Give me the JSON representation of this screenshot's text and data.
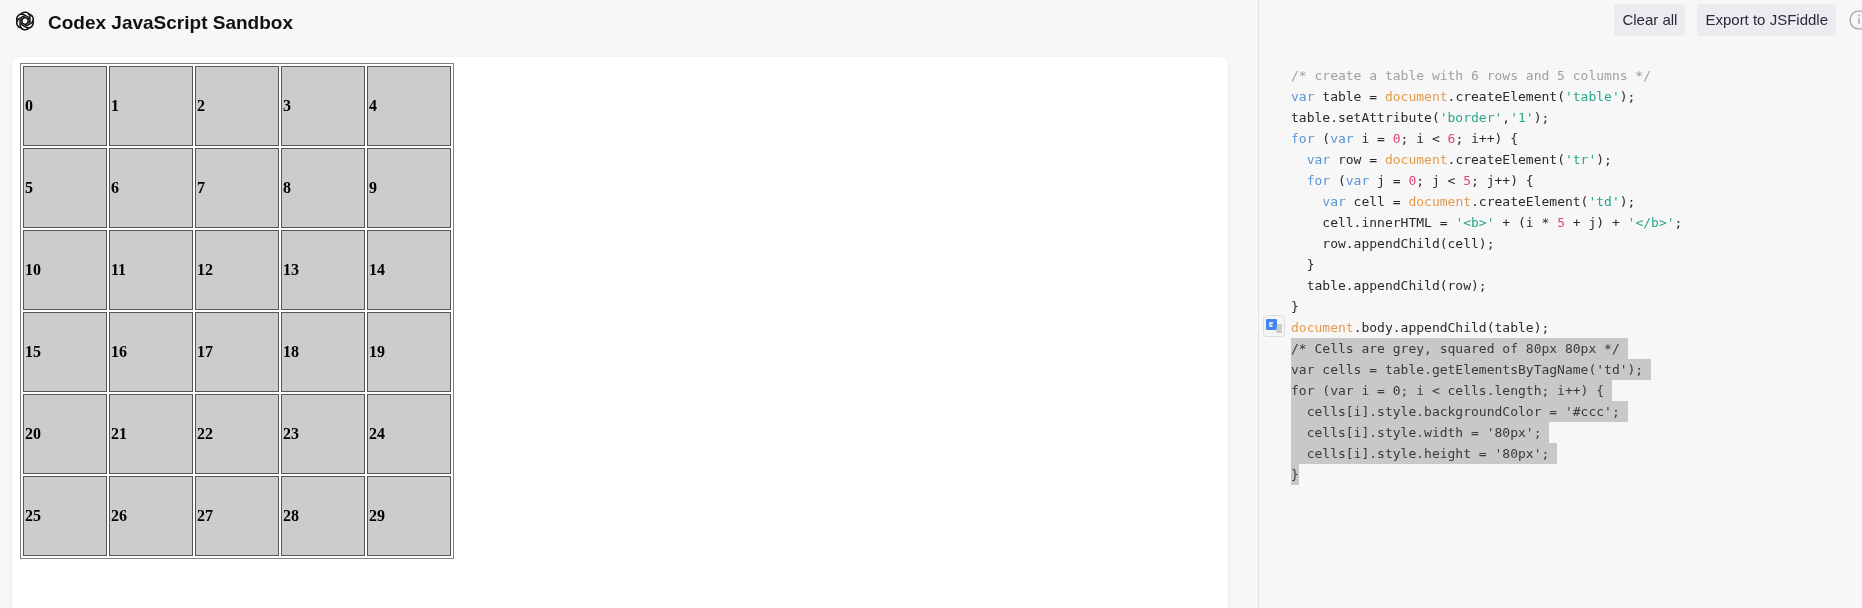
{
  "header": {
    "title": "Codex JavaScript Sandbox"
  },
  "toolbar": {
    "buttons": [
      "Clear all",
      "Export to JSFiddle"
    ]
  },
  "output": {
    "table": {
      "rows": [
        [
          "0",
          "1",
          "2",
          "3",
          "4"
        ],
        [
          "5",
          "6",
          "7",
          "8",
          "9"
        ],
        [
          "10",
          "11",
          "12",
          "13",
          "14"
        ],
        [
          "15",
          "16",
          "17",
          "18",
          "19"
        ],
        [
          "20",
          "21",
          "22",
          "23",
          "24"
        ],
        [
          "25",
          "26",
          "27",
          "28",
          "29"
        ]
      ]
    }
  },
  "code": {
    "lines": [
      {
        "selected": false,
        "tokens": [
          {
            "kind": "comment",
            "text": "/* create a table with 6 rows and 5 columns */"
          }
        ]
      },
      {
        "selected": false,
        "tokens": [
          {
            "kind": "keyword",
            "text": "var"
          },
          {
            "kind": "plain",
            "text": " table = "
          },
          {
            "kind": "object",
            "text": "document"
          },
          {
            "kind": "plain",
            "text": ".createElement("
          },
          {
            "kind": "string",
            "text": "'table'"
          },
          {
            "kind": "plain",
            "text": ");"
          }
        ]
      },
      {
        "selected": false,
        "tokens": [
          {
            "kind": "plain",
            "text": "table.setAttribute("
          },
          {
            "kind": "string",
            "text": "'border'"
          },
          {
            "kind": "plain",
            "text": ","
          },
          {
            "kind": "string",
            "text": "'1'"
          },
          {
            "kind": "plain",
            "text": ");"
          }
        ]
      },
      {
        "selected": false,
        "tokens": [
          {
            "kind": "keyword",
            "text": "for"
          },
          {
            "kind": "plain",
            "text": " ("
          },
          {
            "kind": "keyword",
            "text": "var"
          },
          {
            "kind": "plain",
            "text": " i = "
          },
          {
            "kind": "number",
            "text": "0"
          },
          {
            "kind": "plain",
            "text": "; i < "
          },
          {
            "kind": "number",
            "text": "6"
          },
          {
            "kind": "plain",
            "text": "; i++) {"
          }
        ]
      },
      {
        "selected": false,
        "tokens": [
          {
            "kind": "keyword",
            "text": "  var"
          },
          {
            "kind": "plain",
            "text": " row = "
          },
          {
            "kind": "object",
            "text": "document"
          },
          {
            "kind": "plain",
            "text": ".createElement("
          },
          {
            "kind": "string",
            "text": "'tr'"
          },
          {
            "kind": "plain",
            "text": ");"
          }
        ]
      },
      {
        "selected": false,
        "tokens": [
          {
            "kind": "keyword",
            "text": "  for"
          },
          {
            "kind": "plain",
            "text": " ("
          },
          {
            "kind": "keyword",
            "text": "var"
          },
          {
            "kind": "plain",
            "text": " j = "
          },
          {
            "kind": "number",
            "text": "0"
          },
          {
            "kind": "plain",
            "text": "; j < "
          },
          {
            "kind": "number",
            "text": "5"
          },
          {
            "kind": "plain",
            "text": "; j++) {"
          }
        ]
      },
      {
        "selected": false,
        "tokens": [
          {
            "kind": "keyword",
            "text": "    var"
          },
          {
            "kind": "plain",
            "text": " cell = "
          },
          {
            "kind": "object",
            "text": "document"
          },
          {
            "kind": "plain",
            "text": ".createElement("
          },
          {
            "kind": "string",
            "text": "'td'"
          },
          {
            "kind": "plain",
            "text": ");"
          }
        ]
      },
      {
        "selected": false,
        "tokens": [
          {
            "kind": "plain",
            "text": "    cell.innerHTML = "
          },
          {
            "kind": "string",
            "text": "'<b>'"
          },
          {
            "kind": "plain",
            "text": " + (i * "
          },
          {
            "kind": "number",
            "text": "5"
          },
          {
            "kind": "plain",
            "text": " + j) + "
          },
          {
            "kind": "string",
            "text": "'</b>'"
          },
          {
            "kind": "plain",
            "text": ";"
          }
        ]
      },
      {
        "selected": false,
        "tokens": [
          {
            "kind": "plain",
            "text": "    row.appendChild(cell);"
          }
        ]
      },
      {
        "selected": false,
        "tokens": [
          {
            "kind": "plain",
            "text": "  }"
          }
        ]
      },
      {
        "selected": false,
        "tokens": [
          {
            "kind": "plain",
            "text": "  table.appendChild(row);"
          }
        ]
      },
      {
        "selected": false,
        "tokens": [
          {
            "kind": "plain",
            "text": "}"
          }
        ]
      },
      {
        "selected": false,
        "tokens": [
          {
            "kind": "object",
            "text": "document"
          },
          {
            "kind": "plain",
            "text": ".body.appendChild(table);"
          }
        ]
      },
      {
        "selected": true,
        "text": "/* Cells are grey, squared of 80px 80px */ "
      },
      {
        "selected": true,
        "text": "var cells = table.getElementsByTagName('td'); "
      },
      {
        "selected": true,
        "text": "for (var i = 0; i < cells.length; i++) { "
      },
      {
        "selected": true,
        "text": "  cells[i].style.backgroundColor = '#ccc'; "
      },
      {
        "selected": true,
        "text": "  cells[i].style.width = '80px'; "
      },
      {
        "selected": true,
        "text": "  cells[i].style.height = '80px'; "
      },
      {
        "selected": true,
        "text": "}"
      }
    ]
  }
}
